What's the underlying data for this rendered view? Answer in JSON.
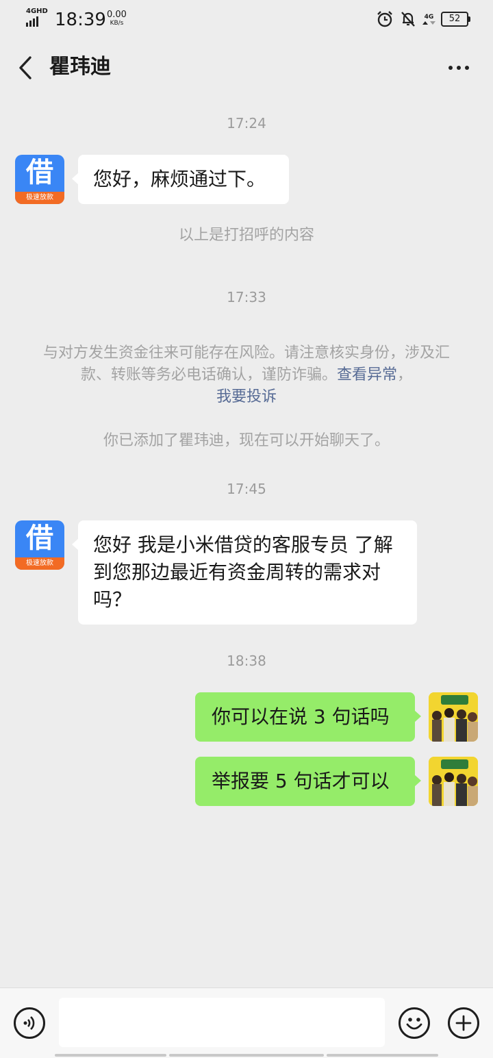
{
  "status_bar": {
    "network": "4GHD",
    "time": "18:39",
    "speed_value": "0.00",
    "speed_unit": "KB/s",
    "network_right": "4G",
    "battery": "52"
  },
  "header": {
    "title": "瞿玮迪"
  },
  "avatars": {
    "contact_glyph": "借",
    "contact_tag": "极速放款"
  },
  "chat": {
    "time_1": "17:24",
    "msg_1": "您好，麻烦通过下。",
    "greeting_note": "以上是打招呼的内容",
    "time_2": "17:33",
    "warning_text": "与对方发生资金往来可能存在风险。请注意核实身份，涉及汇款、转账等务必电话确认，谨防诈骗。",
    "warning_link_1": "查看异常",
    "warning_sep": "，",
    "warning_link_2": "我要投诉",
    "added_note": "你已添加了瞿玮迪，现在可以开始聊天了。",
    "time_3": "17:45",
    "msg_2": "您好 我是小米借贷的客服专员 了解到您那边最近有资金周转的需求对吗？",
    "time_4": "18:38",
    "msg_3": "你可以在说 3 句话吗",
    "msg_4": "举报要 5 句话才可以"
  },
  "input": {
    "placeholder": ""
  },
  "colors": {
    "background": "#ededed",
    "bubble_self": "#95ec69",
    "bubble_other": "#ffffff",
    "link": "#576b95",
    "avatar_blue": "#3a86f5",
    "avatar_orange": "#f26b24"
  },
  "icons": [
    "back-arrow-icon",
    "more-dots-icon",
    "voice-icon",
    "emoji-icon",
    "plus-icon",
    "alarm-icon",
    "mute-bell-icon",
    "battery-icon",
    "signal-icon"
  ]
}
